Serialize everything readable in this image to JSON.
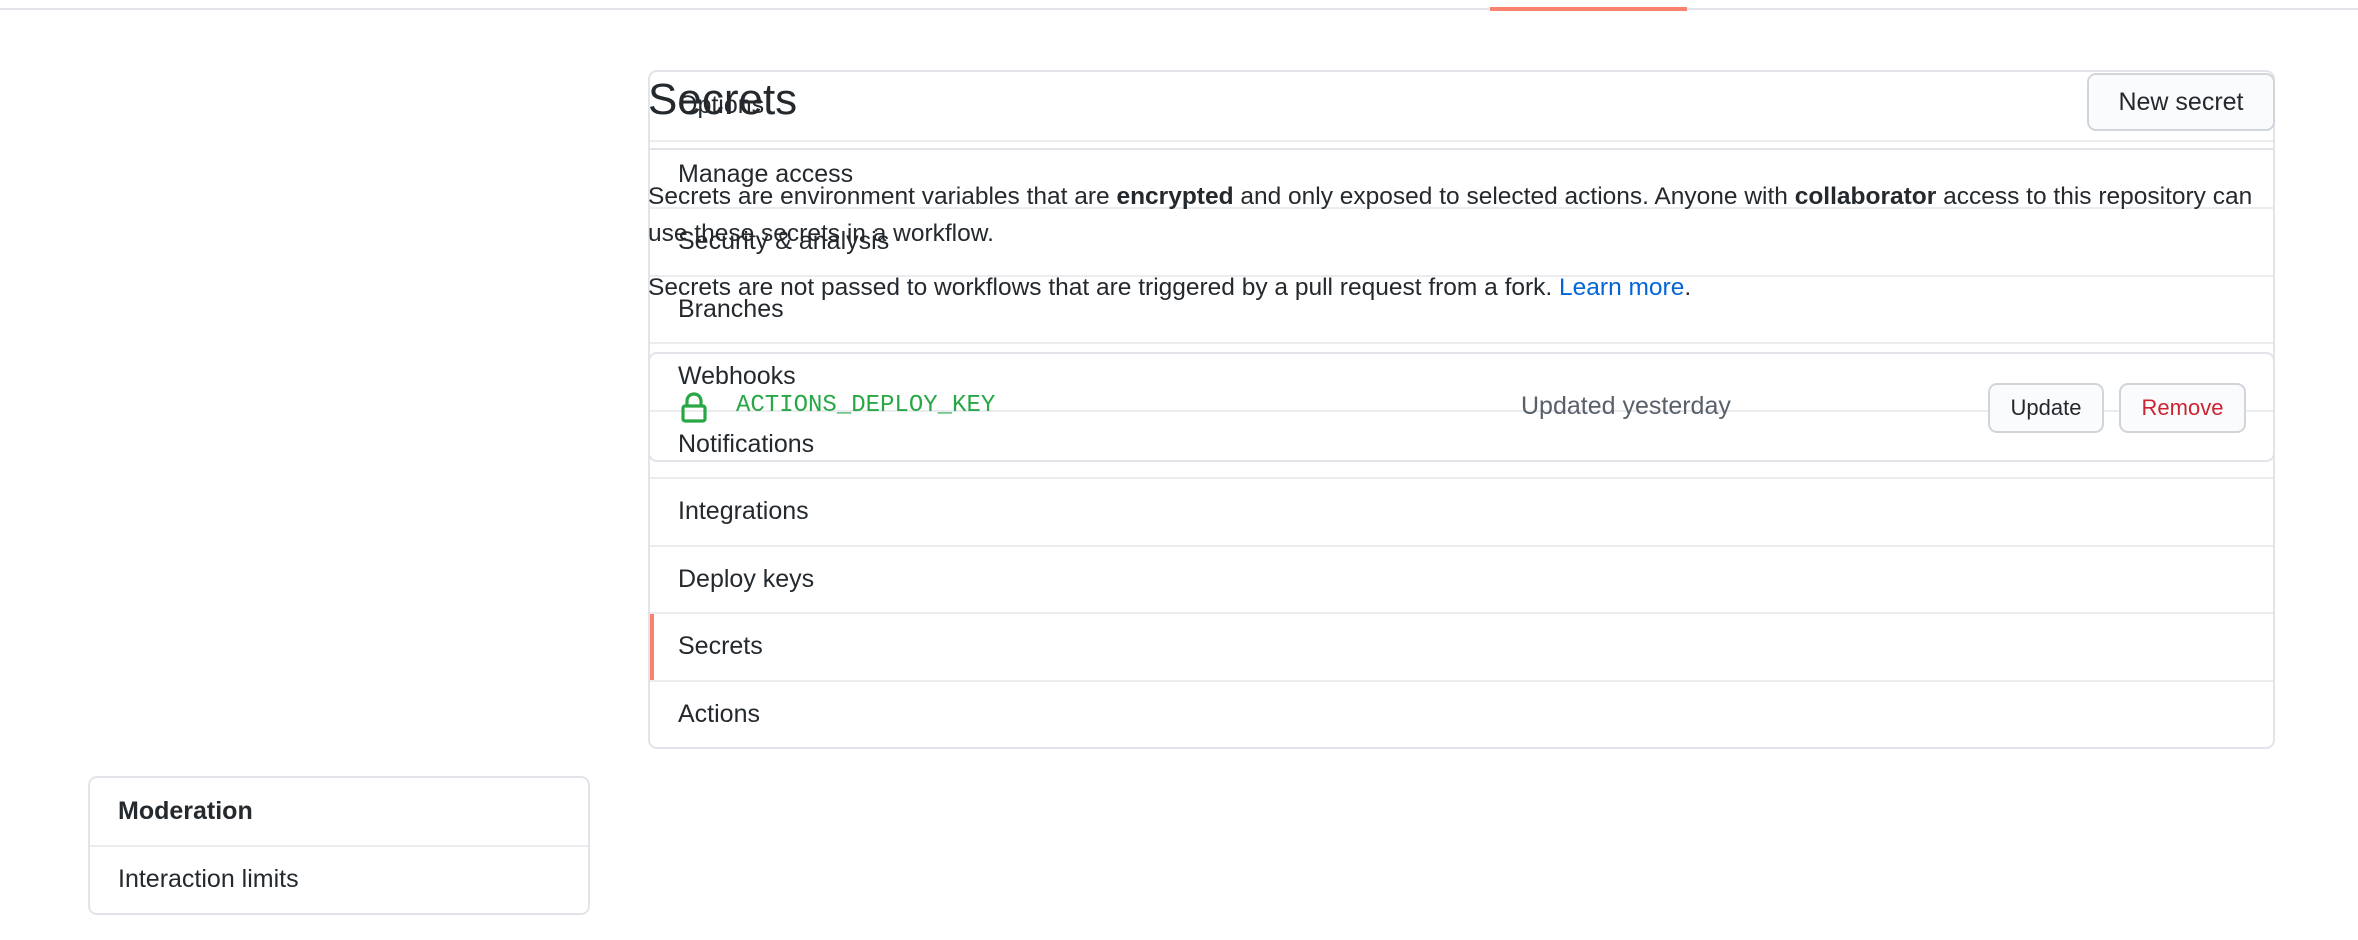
{
  "sidebar": {
    "items": [
      {
        "label": "Options"
      },
      {
        "label": "Manage access"
      },
      {
        "label": "Security & analysis"
      },
      {
        "label": "Branches"
      },
      {
        "label": "Webhooks"
      },
      {
        "label": "Notifications"
      },
      {
        "label": "Integrations"
      },
      {
        "label": "Deploy keys"
      },
      {
        "label": "Secrets",
        "selected": true
      },
      {
        "label": "Actions"
      }
    ],
    "moderation": {
      "heading": "Moderation",
      "items": [
        {
          "label": "Interaction limits"
        }
      ]
    }
  },
  "main": {
    "title": "Secrets",
    "new_secret_label": "New secret",
    "description": {
      "part1": "Secrets are environment variables that are ",
      "bold1": "encrypted",
      "part2": " and only exposed to selected actions. Anyone with ",
      "bold2": "collaborator",
      "part3": " access to this repository can use these secrets in a workflow."
    },
    "fork_note": {
      "text": "Secrets are not passed to workflows that are triggered by a pull request from a fork. ",
      "link": "Learn more",
      "suffix": "."
    },
    "secrets": [
      {
        "name": "ACTIONS_DEPLOY_KEY",
        "updated": "Updated yesterday",
        "update_label": "Update",
        "remove_label": "Remove"
      }
    ]
  },
  "colors": {
    "accent": "#f9826c",
    "link": "#0366d6",
    "secret_green": "#28a745",
    "danger": "#cb2431"
  }
}
